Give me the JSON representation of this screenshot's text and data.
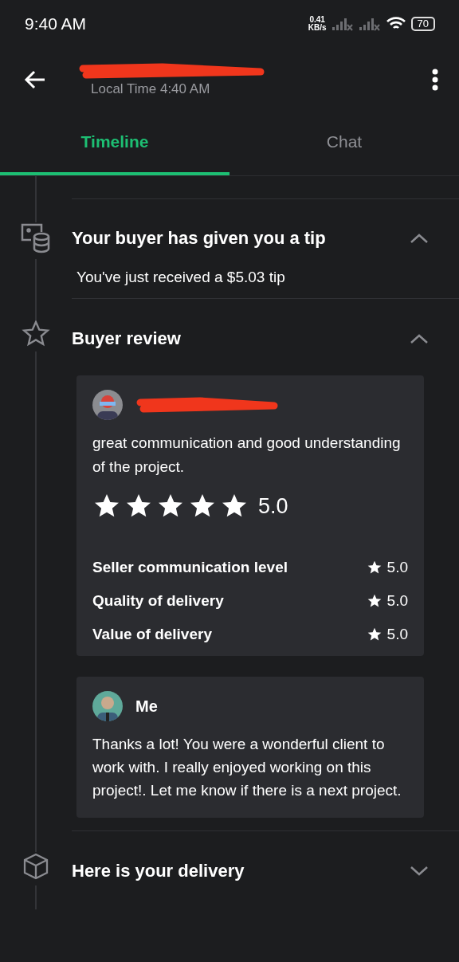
{
  "status_bar": {
    "time": "9:40 AM",
    "speed": "0.41",
    "speed_unit": "KB/s",
    "battery": "70"
  },
  "header": {
    "subtitle": "Local Time 4:40 AM"
  },
  "tabs": [
    {
      "label": "Timeline",
      "selected": true
    },
    {
      "label": "Chat",
      "selected": false
    }
  ],
  "timeline": [
    {
      "kind": "tip",
      "title": "Your buyer has given you a tip",
      "expanded": true,
      "text": "You've just received a $5.03 tip"
    },
    {
      "kind": "review",
      "title": "Buyer review",
      "expanded": true,
      "review": {
        "comment": "great communication and good understanding of the project.",
        "stars": 5,
        "rating": "5.0",
        "criteria": [
          {
            "label": "Seller communication level",
            "rating": "5.0"
          },
          {
            "label": "Quality of delivery",
            "rating": "5.0"
          },
          {
            "label": "Value of delivery",
            "rating": "5.0"
          }
        ]
      },
      "reply": {
        "author": "Me",
        "text": "Thanks a lot!   You were a wonderful client to work with.  I really enjoyed working on this project!.  Let me know if there is a next project."
      }
    },
    {
      "kind": "delivery",
      "title": "Here is your delivery",
      "expanded": false
    }
  ]
}
